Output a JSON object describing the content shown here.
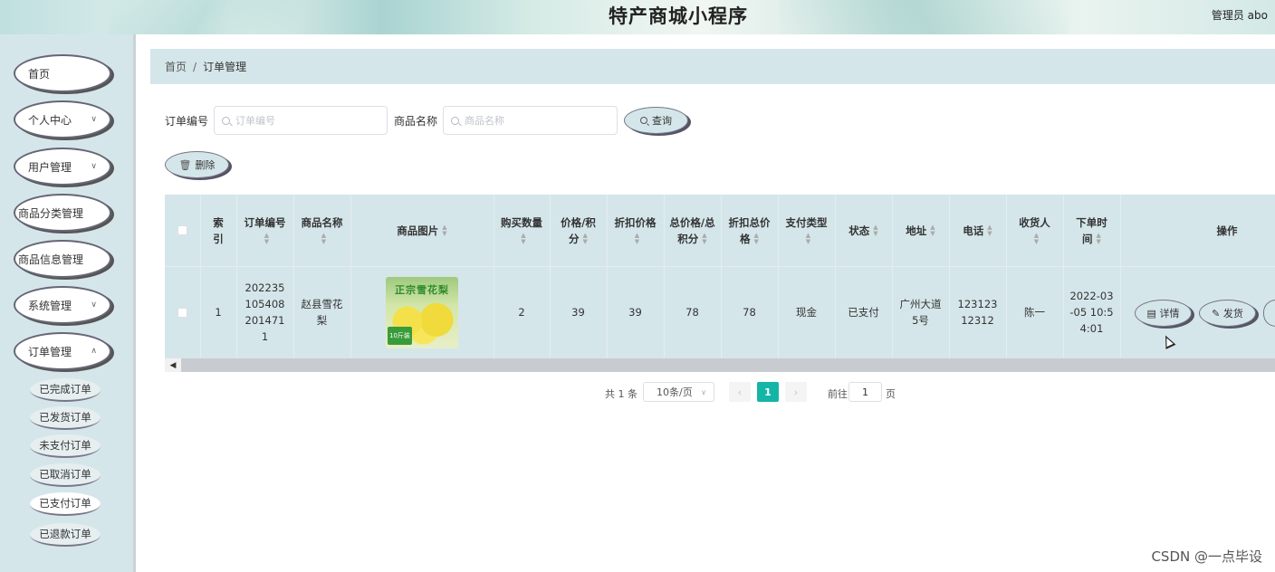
{
  "header": {
    "title": "特产商城小程序",
    "user": "管理员 abo"
  },
  "sidebar": {
    "items": [
      {
        "label": "首页"
      },
      {
        "label": "个人中心"
      },
      {
        "label": "用户管理"
      },
      {
        "label": "商品分类管理"
      },
      {
        "label": "商品信息管理"
      },
      {
        "label": "系统管理"
      },
      {
        "label": "订单管理"
      }
    ],
    "sub_items": [
      {
        "label": "已完成订单"
      },
      {
        "label": "已发货订单"
      },
      {
        "label": "未支付订单"
      },
      {
        "label": "已取消订单"
      },
      {
        "label": "已支付订单"
      },
      {
        "label": "已退款订单"
      }
    ]
  },
  "breadcrumb": {
    "home": "首页",
    "separator": "/",
    "current": "订单管理"
  },
  "search": {
    "order_no_label": "订单编号",
    "order_no_placeholder": "订单编号",
    "product_name_label": "商品名称",
    "product_name_placeholder": "商品名称",
    "query_button": "查询",
    "delete_button": "删除"
  },
  "table": {
    "headers": {
      "index": "索引",
      "order_no": "订单编号",
      "product_name": "商品名称",
      "product_image": "商品图片",
      "quantity": "购买数量",
      "price": "价格/积分",
      "discount_price": "折扣价格",
      "total_price": "总价格/总积分",
      "discount_total": "折扣总价格",
      "pay_type": "支付类型",
      "status": "状态",
      "address": "地址",
      "phone": "电话",
      "receiver": "收货人",
      "order_time": "下单时间",
      "actions": "操作"
    },
    "rows": [
      {
        "index": "1",
        "order_no": "2022351054082014711",
        "product_name": "赵县雪花梨",
        "image_text": "正宗雪花梨",
        "image_tag": "10斤装",
        "quantity": "2",
        "price": "39",
        "discount_price": "39",
        "total_price": "78",
        "discount_total": "78",
        "pay_type": "现金",
        "status": "已支付",
        "address": "广州大道5号",
        "phone": "12312312312",
        "receiver": "陈一",
        "order_time": "2022-03-05 10:54:01"
      }
    ],
    "action_detail": "详情",
    "action_ship": "发货"
  },
  "pagination": {
    "total": "共 1 条",
    "page_size": "10条/页",
    "current_page": "1",
    "goto_prefix": "前往",
    "goto_value": "1",
    "goto_suffix": "页"
  },
  "watermark": "CSDN @一点毕设"
}
